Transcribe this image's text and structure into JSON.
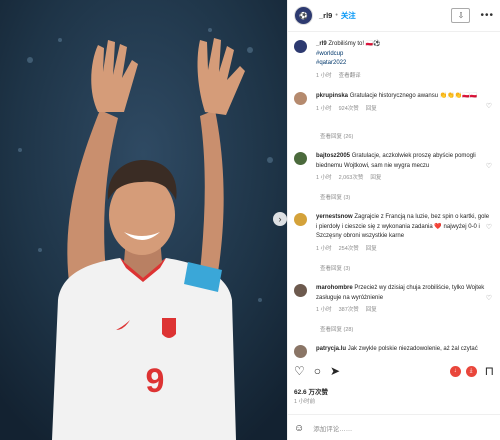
{
  "post": {
    "username": "_rl9",
    "separator": "•",
    "follow_label": "关注",
    "caption_text": "Zrobiliśmy to! 🇵🇱⚽",
    "hashtag1": "#worldcup",
    "hashtag2": "#qatar2022",
    "caption_time": "1 小时",
    "caption_translate": "查看翻译",
    "likes": "62.6 万次赞",
    "date": "1 小时前",
    "add_comment_placeholder": "添加评论……",
    "player_number": "9"
  },
  "comments": [
    {
      "user": "pkrupinska",
      "text": "Gratulacje historycznego awansu 👏👏👏🇵🇱🇵🇱",
      "time": "1 小时",
      "likes": "924次赞",
      "reply": "回复",
      "replies": "查看回复 (26)",
      "avatar_color": "#b58a6e"
    },
    {
      "user": "bajtosz2005",
      "text": "Gratulacje, aczkolwiek proszę abyście pomogli biednemu Wojtkowi, sam nie wygra meczu",
      "time": "1 小时",
      "likes": "2,063次赞",
      "reply": "回复",
      "replies": "查看回复 (3)",
      "avatar_color": "#4b6a3c"
    },
    {
      "user": "yernestsnow",
      "text": "Zagrajcie z Francją na luzie, bez spin o kartki, gole i pierdoły i cieszcie się z wykonania zadania ❤️ najwyżej 0-0 i Szczęsny obroni wszystkie karne",
      "time": "1 小时",
      "likes": "254次赞",
      "reply": "回复",
      "replies": "查看回复 (3)",
      "avatar_color": "#d4a23a"
    },
    {
      "user": "marohombre",
      "text": "Przecież wy dzisiaj chuja zrobiliście, tylko Wojtek zasługuje na wyróżnienie",
      "time": "1 小时",
      "likes": "387次赞",
      "reply": "回复",
      "replies": "查看回复 (28)",
      "avatar_color": "#6d5a4e"
    },
    {
      "user": "patrycja.lu",
      "text": "Jak zwykle polskie niezadowolenie, aż żal czytać",
      "avatar_color": "#8a7566"
    }
  ],
  "icons": {
    "more": "•••",
    "heart": "♡",
    "comment": "○",
    "share": "➤",
    "bookmark": "⊓",
    "download": "⇩",
    "smile": "☺",
    "next": "›"
  },
  "colors": {
    "link": "#00376b",
    "follow": "#0095f6",
    "shirt": "#f2f2f2",
    "background": "#1c2e3e"
  }
}
